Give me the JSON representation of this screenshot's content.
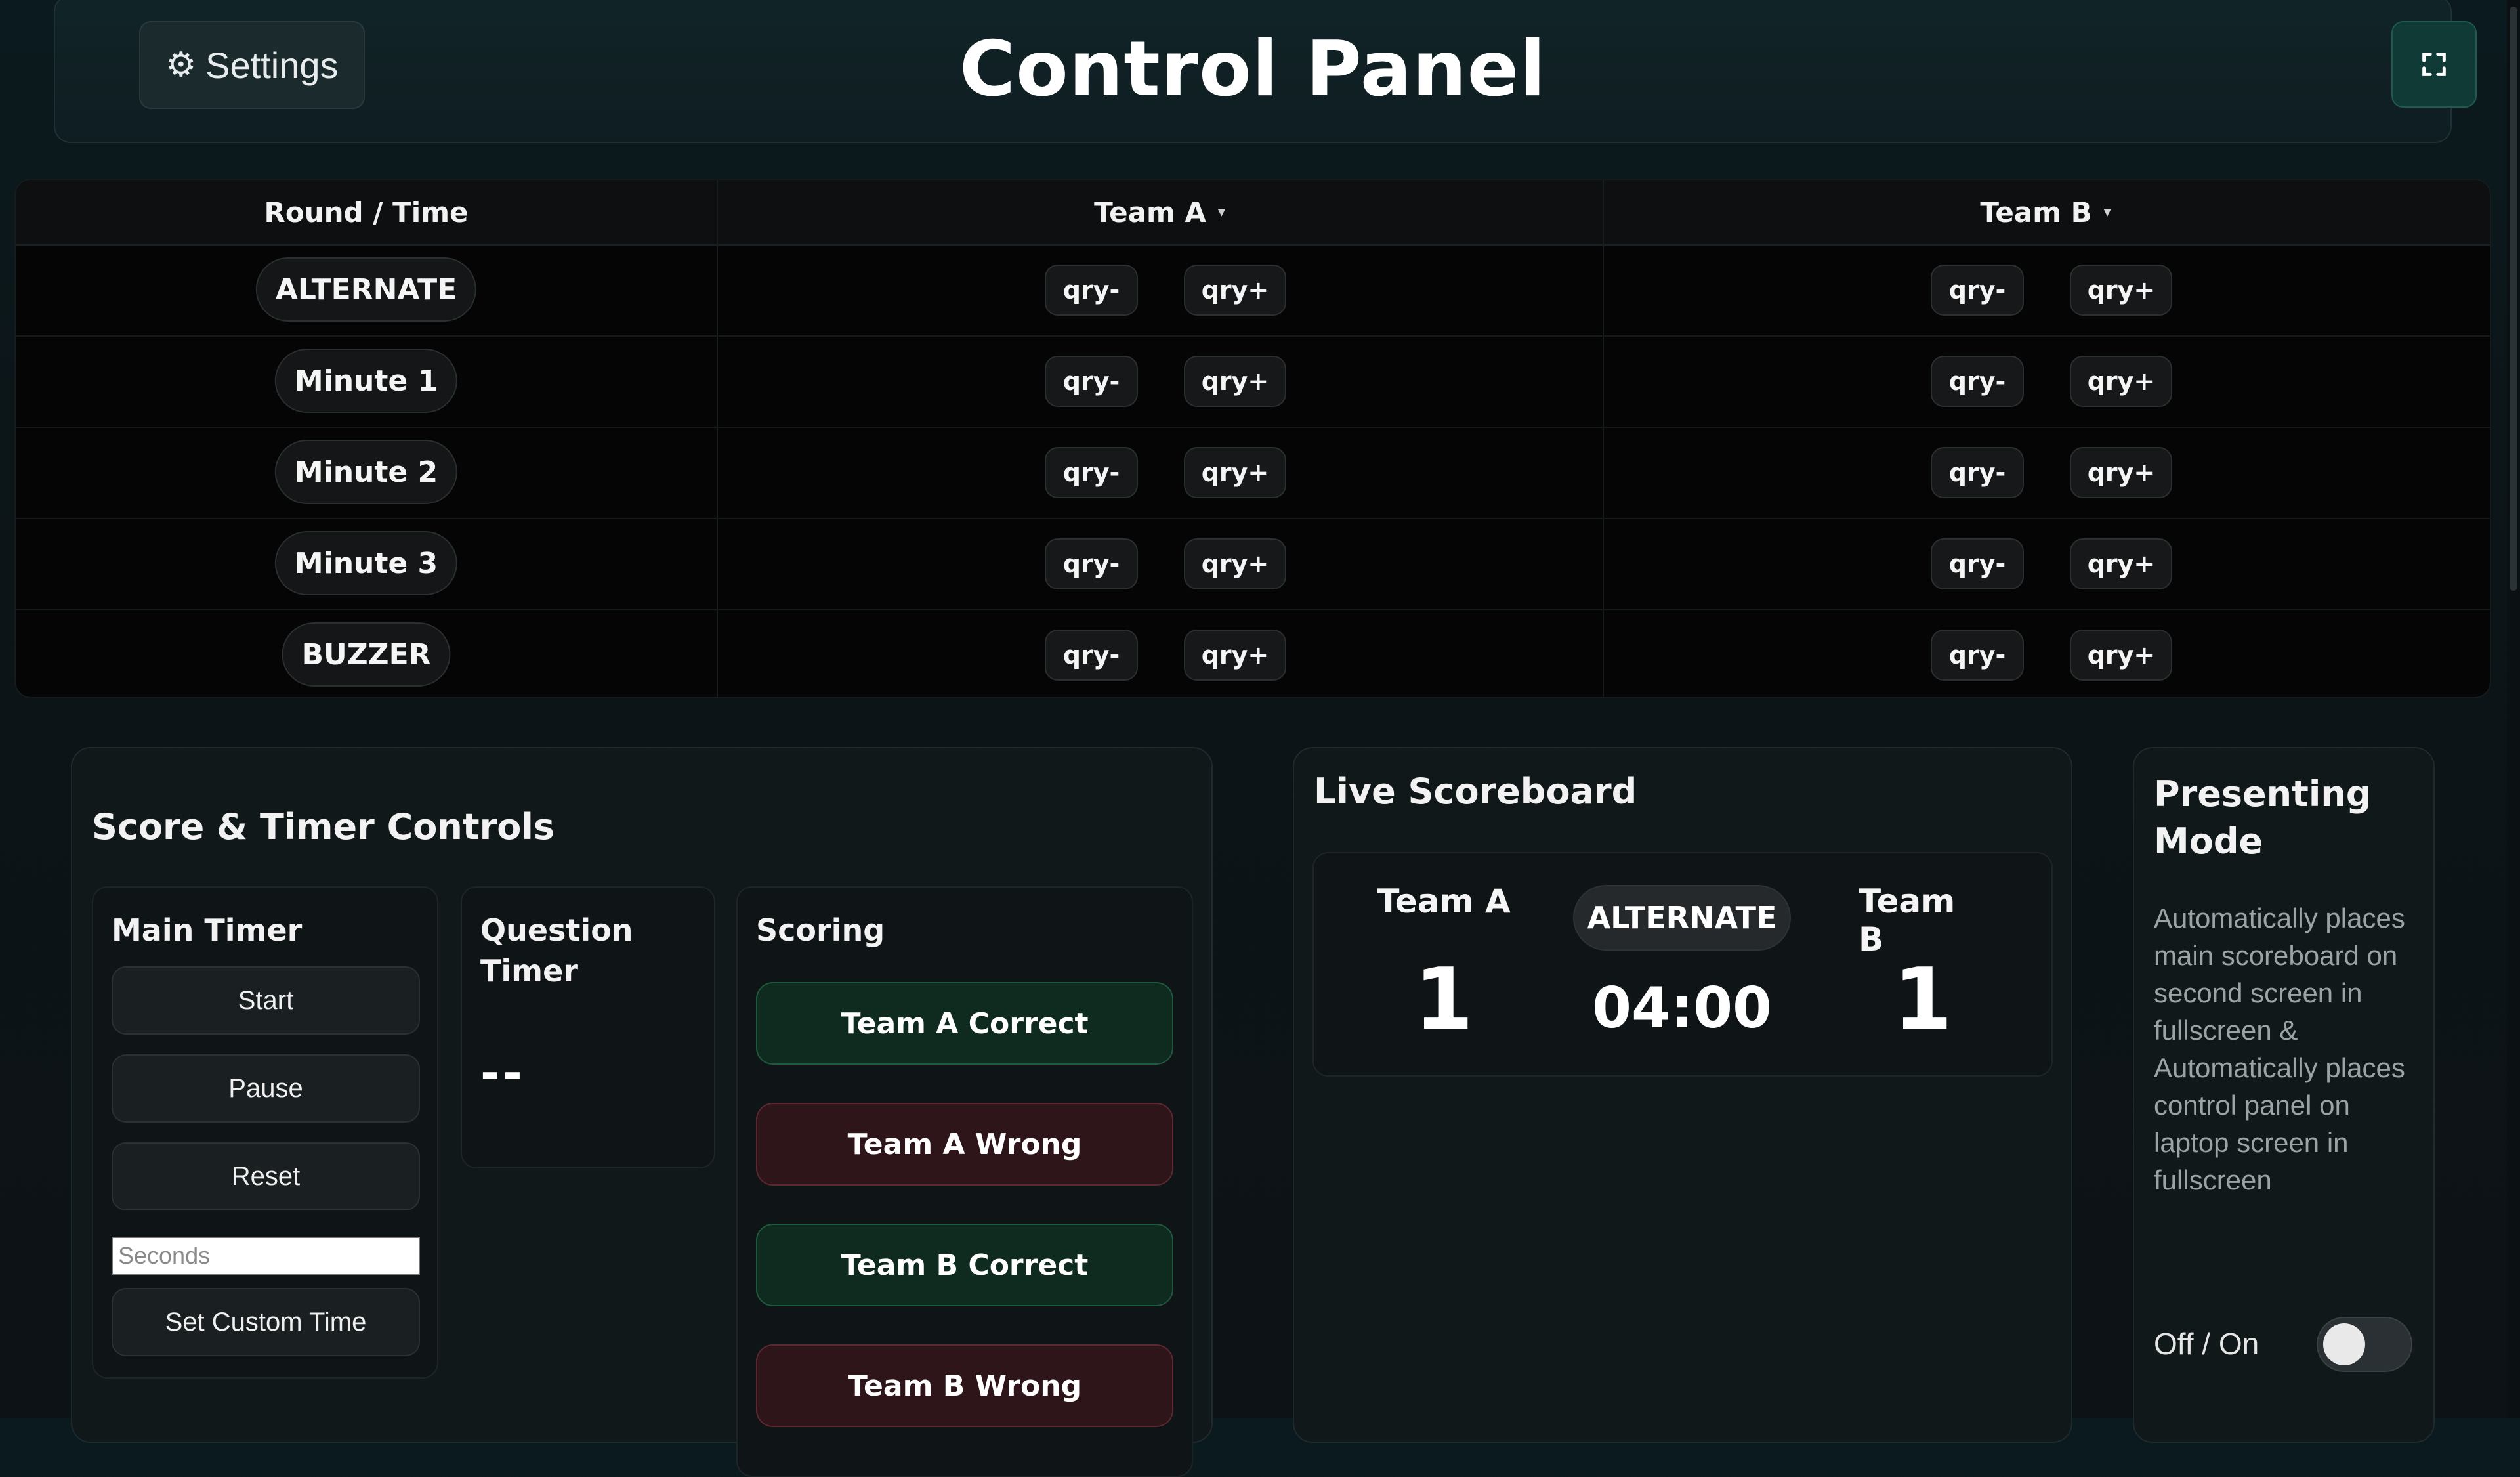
{
  "header": {
    "settings_icon": "⚙",
    "settings_label": "Settings",
    "title": "Control Panel",
    "fullscreen_icon": "fullscreen-icon"
  },
  "table": {
    "columns": [
      "Round / Time",
      "Team A",
      "Team B"
    ],
    "column_caret": "▾",
    "rounds": [
      "ALTERNATE",
      "Minute 1",
      "Minute 2",
      "Minute 3",
      "BUZZER"
    ],
    "minus_label": "qry-",
    "plus_label": "qry+"
  },
  "controls": {
    "title": "Score & Timer Controls",
    "main_timer": {
      "title": "Main Timer",
      "start": "Start",
      "pause": "Pause",
      "reset": "Reset",
      "seconds_placeholder": "Seconds",
      "set_custom": "Set Custom Time"
    },
    "question_timer": {
      "title": "Question Timer",
      "value": "--"
    },
    "scoring": {
      "title": "Scoring",
      "buttons": [
        "Team A Correct",
        "Team A Wrong",
        "Team B Correct",
        "Team B Wrong"
      ]
    }
  },
  "scoreboard": {
    "title": "Live Scoreboard",
    "team_a": "Team A",
    "team_b": "Team B",
    "score_a": "1",
    "score_b": "1",
    "round": "ALTERNATE",
    "time": "04:00"
  },
  "presenting": {
    "title": "Presenting Mode",
    "description": "Automatically places main scoreboard on second screen in fullscreen & Automatically places control panel on laptop screen in fullscreen",
    "toggle_label": "Off / On",
    "enabled": false
  },
  "colors": {
    "correct_bg": "#0f2a1f",
    "wrong_bg": "#2e1519",
    "accent_teal": "#103a36"
  }
}
